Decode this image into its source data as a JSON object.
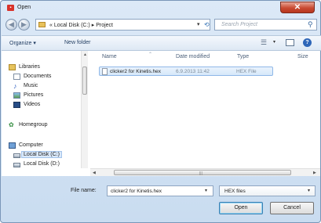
{
  "window": {
    "title": "Open",
    "close_glyph": "✕"
  },
  "nav": {
    "address_prefix": "«",
    "breadcrumb": [
      "Local Disk (C:)",
      "Project"
    ],
    "breadcrumb_sep": "▸",
    "search_placeholder": "Search Project"
  },
  "toolbar": {
    "organize": "Organize ▾",
    "new_folder": "New folder",
    "help": "?"
  },
  "sidebar": {
    "items": [
      {
        "label": "Libraries",
        "icon": "libraries-icon"
      },
      {
        "label": "Documents",
        "icon": "documents-icon"
      },
      {
        "label": "Music",
        "icon": "music-icon"
      },
      {
        "label": "Pictures",
        "icon": "pictures-icon"
      },
      {
        "label": "Videos",
        "icon": "videos-icon"
      },
      {
        "label": "Homegroup",
        "icon": "homegroup-icon"
      },
      {
        "label": "Computer",
        "icon": "computer-icon"
      },
      {
        "label": "Local Disk (C:)",
        "icon": "disk-icon",
        "selected": true
      },
      {
        "label": "Local Disk (D:)",
        "icon": "disk-icon"
      }
    ]
  },
  "file_list": {
    "columns": [
      "Name",
      "Date modified",
      "Type",
      "Size"
    ],
    "rows": [
      {
        "name": "clicker2 for Kinetis.hex",
        "date": "6.9.2013 11:42",
        "type": "HEX File",
        "size": ""
      }
    ]
  },
  "footer": {
    "file_name_label": "File name:",
    "file_name_value": "clicker2 for Kinetis.hex",
    "file_type": "HEX files",
    "open_label": "Open",
    "cancel_label": "Cancel"
  },
  "colors": {
    "accent": "#3c7fb1",
    "selection": "#d6e8fa",
    "close": "#c94b32"
  }
}
